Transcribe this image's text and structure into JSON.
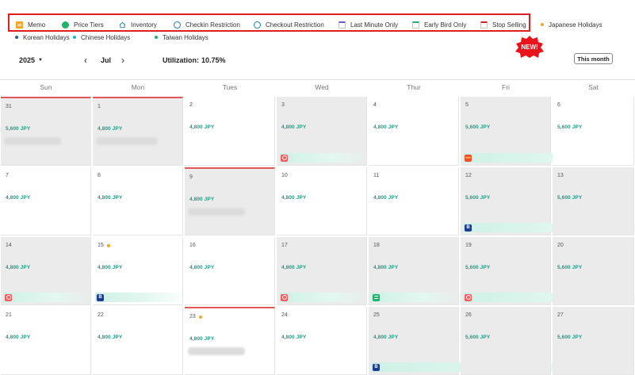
{
  "legend": {
    "row1": [
      {
        "id": "memo",
        "label": "Memo",
        "icon": "memo-icon"
      },
      {
        "id": "price-tiers",
        "label": "Price Tiers",
        "icon": "price-tiers-icon"
      },
      {
        "id": "inventory",
        "label": "Inventory",
        "icon": "house-icon"
      },
      {
        "id": "checkin",
        "label": "Checkin Restriction",
        "icon": "checkin-restriction-icon"
      },
      {
        "id": "checkout",
        "label": "Checkout Restriction",
        "icon": "checkout-restriction-icon"
      },
      {
        "id": "last-minute",
        "label": "Last Minute Only",
        "icon": "calendar-icon",
        "color": "#6a5acd"
      },
      {
        "id": "early-bird",
        "label": "Early Bird Only",
        "icon": "calendar-icon",
        "color": "#20b26b"
      },
      {
        "id": "stop-selling",
        "label": "Stop Selling",
        "icon": "calendar-icon",
        "color": "#e01e1e"
      }
    ],
    "japanese_holidays": {
      "label": "Japanese Holidays",
      "color": "#f5a623"
    },
    "row2": [
      {
        "id": "korean",
        "label": "Korean Holidays",
        "color": "#1a5fa8"
      },
      {
        "id": "chinese",
        "label": "Chinese Holidays",
        "color": "#17b8c8"
      },
      {
        "id": "taiwan",
        "label": "Taiwan Holidays",
        "color": "#20b26b"
      }
    ],
    "new_badge": "NEW!"
  },
  "toolbar": {
    "year": "2025",
    "month": "Jul",
    "prev_icon": "‹",
    "next_icon": "›",
    "utilization_label": "Utilization:",
    "utilization_value": "10.75%",
    "this_month": "This month"
  },
  "weekdays": [
    "Sun",
    "Mon",
    "Tues",
    "Wed",
    "Thur",
    "Fri",
    "Sat"
  ],
  "weeks": [
    [
      {
        "date": "31",
        "price": "5,600 JPY",
        "grey": true,
        "today": true,
        "blur": 72
      },
      {
        "date": "1",
        "price": "4,800 JPY",
        "grey": true,
        "today": true,
        "blur": 78
      },
      {
        "date": "2",
        "price": "4,800 JPY",
        "grey": false
      },
      {
        "date": "3",
        "price": "4,800 JPY",
        "grey": true,
        "icon": "air"
      },
      {
        "date": "4",
        "price": "4,800 JPY",
        "grey": false
      },
      {
        "date": "5",
        "price": "5,600 JPY",
        "grey": true,
        "icon": "flag"
      },
      {
        "date": "6",
        "price": "5,600 JPY",
        "grey": false
      }
    ],
    [
      {
        "date": "7",
        "price": "4,800 JPY",
        "grey": false
      },
      {
        "date": "8",
        "price": "4,800 JPY",
        "grey": false
      },
      {
        "date": "9",
        "price": "4,800 JPY",
        "grey": true,
        "today": true,
        "blur": 72
      },
      {
        "date": "10",
        "price": "4,800 JPY",
        "grey": false
      },
      {
        "date": "11",
        "price": "4,800 JPY",
        "grey": false
      },
      {
        "date": "12",
        "price": "5,600 JPY",
        "grey": true,
        "icon": "booking"
      },
      {
        "date": "13",
        "price": "5,600 JPY",
        "grey": true
      }
    ],
    [
      {
        "date": "14",
        "price": "4,800 JPY",
        "grey": true,
        "icon": "air"
      },
      {
        "date": "15",
        "price": "4,800 JPY",
        "grey": false,
        "holiday": true,
        "icon": "booking"
      },
      {
        "date": "16",
        "price": "4,800 JPY",
        "grey": false
      },
      {
        "date": "17",
        "price": "4,800 JPY",
        "grey": true,
        "icon": "air"
      },
      {
        "date": "18",
        "price": "4,800 JPY",
        "grey": true,
        "icon": "green"
      },
      {
        "date": "19",
        "price": "5,600 JPY",
        "grey": true,
        "icon": "air"
      },
      {
        "date": "20",
        "price": "5,600 JPY",
        "grey": true
      }
    ],
    [
      {
        "date": "21",
        "price": "4,800 JPY",
        "grey": false
      },
      {
        "date": "22",
        "price": "4,800 JPY",
        "grey": false
      },
      {
        "date": "23",
        "price": "4,800 JPY",
        "grey": false,
        "holiday": true,
        "today": true,
        "blur": 72
      },
      {
        "date": "24",
        "price": "4,800 JPY",
        "grey": false
      },
      {
        "date": "25",
        "price": "4,800 JPY",
        "grey": true,
        "icon": "booking"
      },
      {
        "date": "26",
        "price": "5,600 JPY",
        "grey": true
      },
      {
        "date": "27",
        "price": "5,600 JPY",
        "grey": true
      }
    ]
  ]
}
